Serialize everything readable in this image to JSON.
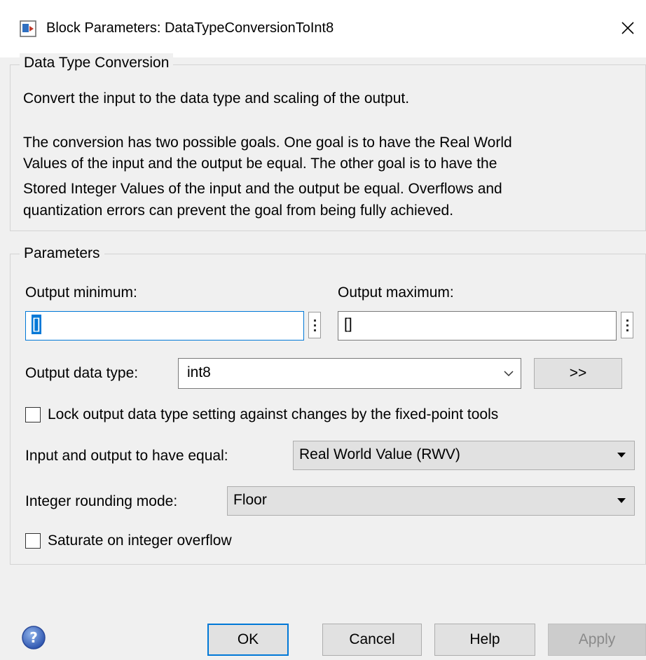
{
  "window": {
    "title": "Block Parameters: DataTypeConversionToInt8",
    "close_glyph": "✕"
  },
  "description_group": {
    "legend": "Data Type Conversion",
    "line1": "Convert the input to the data type and scaling of the output.",
    "para2_line1": "The conversion has two possible goals. One goal is to have the Real World",
    "para2_line2": "Values of the input and the output be equal.  The other goal is to have the",
    "para2_line3": "Stored Integer Values of the input and the output be equal.  Overflows and",
    "para2_line4": "quantization errors can prevent the goal from being fully achieved."
  },
  "parameters": {
    "legend": "Parameters",
    "output_minimum_label": "Output minimum:",
    "output_minimum_value": "[]",
    "output_maximum_label": "Output maximum:",
    "output_maximum_value": "[]",
    "output_data_type_label": "Output data type:",
    "output_data_type_value": "int8",
    "show_assistant_label": ">>",
    "lock_label": "Lock output data type setting against changes by the fixed-point tools",
    "lock_checked": false,
    "equal_label": "Input and output to have equal:",
    "equal_value": "Real World Value (RWV)",
    "rounding_label": "Integer rounding mode:",
    "rounding_value": "Floor",
    "saturate_label": "Saturate on integer overflow",
    "saturate_checked": false
  },
  "buttons": {
    "ok": "OK",
    "cancel": "Cancel",
    "help": "Help",
    "apply": "Apply"
  },
  "colors": {
    "accent": "#0078d7",
    "dialog_bg": "#f0f0f0",
    "button_bg": "#e1e1e1"
  }
}
